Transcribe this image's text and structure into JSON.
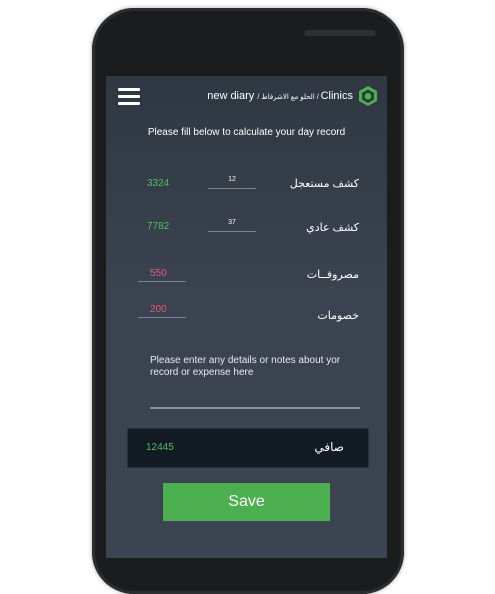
{
  "header": {
    "title_main": "Clinics",
    "title_sub": "/ الحلو مع الاشرفاط / ",
    "title_page": "new diary",
    "logo_icon": "hexagon-leaf-icon"
  },
  "instruction": "Please fill below to calculate your day record",
  "rows": [
    {
      "label": "كشف مستعجل",
      "quantity": "12",
      "total": "3324"
    },
    {
      "label": "كشف عادي",
      "quantity": "37",
      "total": "7782"
    }
  ],
  "expenses": {
    "label": "مصروفــات",
    "value": "550"
  },
  "discounts": {
    "label": "خصومات",
    "value": "200"
  },
  "notes": {
    "placeholder": "Please enter any details or notes about yor record or expense here"
  },
  "net": {
    "label": "صافي",
    "value": "12445"
  },
  "save_label": "Save",
  "colors": {
    "accent_green": "#4caf50",
    "positive": "#4fbf63",
    "negative": "#e65a7a",
    "background": "#333b46"
  }
}
